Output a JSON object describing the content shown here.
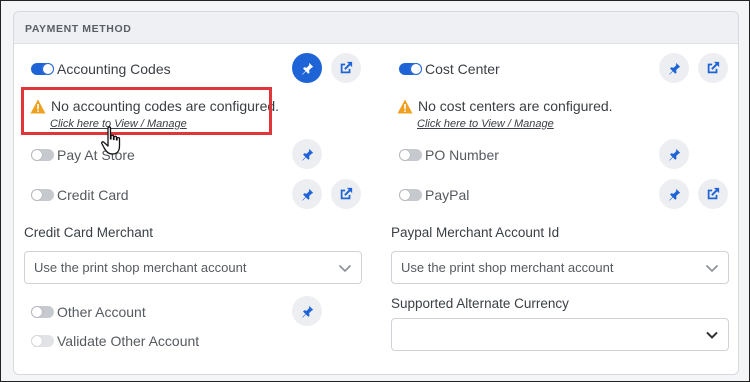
{
  "section": {
    "title": "PAYMENT METHOD"
  },
  "left": {
    "accounting_codes": {
      "label": "Accounting Codes",
      "enabled": true,
      "warning": "No accounting codes are configured.",
      "link": "Click here to View / Manage"
    },
    "pay_at_store": {
      "label": "Pay At Store",
      "enabled": false
    },
    "credit_card": {
      "label": "Credit Card",
      "enabled": false
    },
    "credit_card_merchant": {
      "label": "Credit Card Merchant",
      "value": "Use the print shop merchant account"
    },
    "other_account": {
      "label": "Other Account",
      "enabled": false
    },
    "validate_other_account": {
      "label": "Validate Other Account",
      "enabled": false
    }
  },
  "right": {
    "cost_center": {
      "label": "Cost Center",
      "enabled": true,
      "warning": "No cost centers are configured.",
      "link": "Click here to View / Manage"
    },
    "po_number": {
      "label": "PO Number",
      "enabled": false
    },
    "paypal": {
      "label": "PayPal",
      "enabled": false
    },
    "paypal_merchant": {
      "label": "Paypal Merchant Account Id",
      "value": "Use the print shop merchant account"
    },
    "alternate_currency": {
      "label": "Supported Alternate Currency",
      "value": ""
    }
  },
  "icons": {
    "pin": "pin-icon",
    "external": "external-link-icon",
    "warning": "warning-icon",
    "chevron": "chevron-down-icon",
    "cursor": "hand-pointer-cursor"
  },
  "colors": {
    "accent": "#1e64d6",
    "warning": "#f0a020",
    "highlight": "#e0353b"
  }
}
